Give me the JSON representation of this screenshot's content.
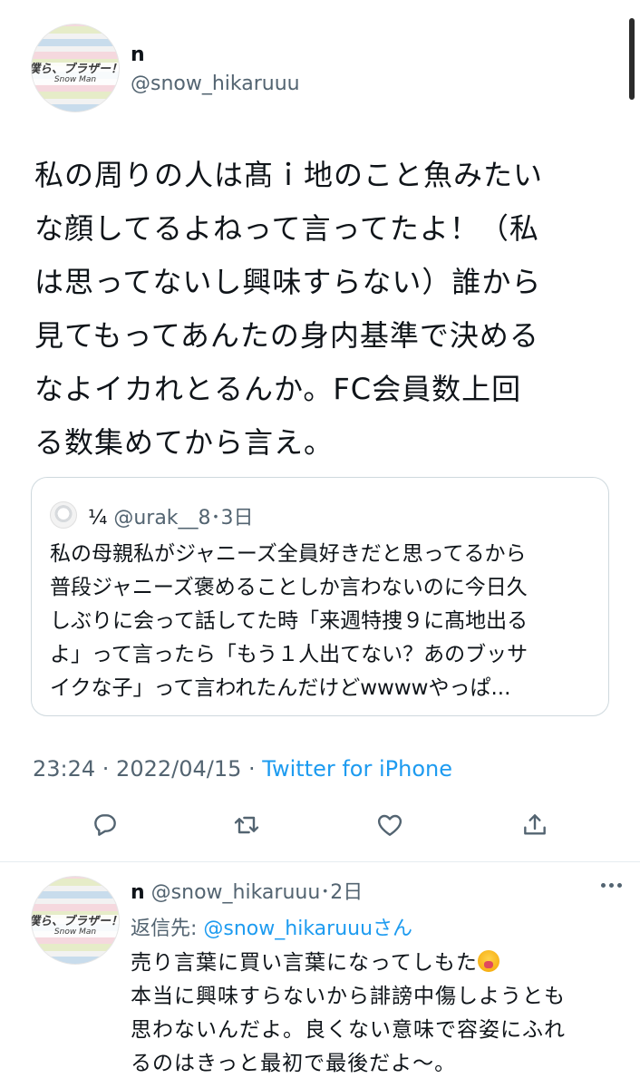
{
  "main_tweet": {
    "avatar": {
      "line1": "僕ら、ブラザー！",
      "line2": "Snow Man"
    },
    "name": "n",
    "handle": "@snow_hikaruuu",
    "text_lines": [
      "私の周りの人は髙ｉ地のこと魚みたい",
      "な顔してるよねって言ってたよ！（私",
      "は思ってないし興味すらない）誰から",
      "見てもってあんたの身内基準で決める",
      "なよイカれとるんか。FC会員数上回",
      "る数集めてから言え。"
    ],
    "quote": {
      "name": "¼",
      "handle_date": "@urak__8･3日",
      "text_lines": [
        "私の母親私がジャニーズ全員好きだと思ってるから",
        "普段ジャニーズ褒めることしか言わないのに今日久",
        "しぶりに会って話してた時「来週特捜９に髙地出る",
        "よ」って言ったら「もう１人出てない？あのブッサ",
        "イクな子」って言われたんだけどwwwwやっぱ..."
      ]
    },
    "time": "23:24 · 2022/04/15 · ",
    "client": "Twitter for iPhone"
  },
  "actions": {
    "reply_icon": "speech-bubble-icon",
    "retweet_icon": "retweet-icon",
    "like_icon": "heart-icon",
    "share_icon": "share-icon"
  },
  "reply": {
    "avatar": {
      "line1": "僕ら、ブラザー！",
      "line2": "Snow Man"
    },
    "name": "n",
    "handle_date": " @snow_hikaruuu･2日",
    "replying_prefix": "返信先: ",
    "replying_to": "@snow_hikaruuuさん",
    "text_line1": "売り言葉に買い言葉になってしもた",
    "text_lines": [
      "本当に興味すらないから誹謗中傷しようとも",
      "思わないんだよ。良くない意味で容姿にふれ",
      "るのはきっと最初で最後だよ〜。"
    ]
  },
  "colors": {
    "accent": "#1d9bf0",
    "muted": "#536471",
    "text": "#0f1419"
  }
}
